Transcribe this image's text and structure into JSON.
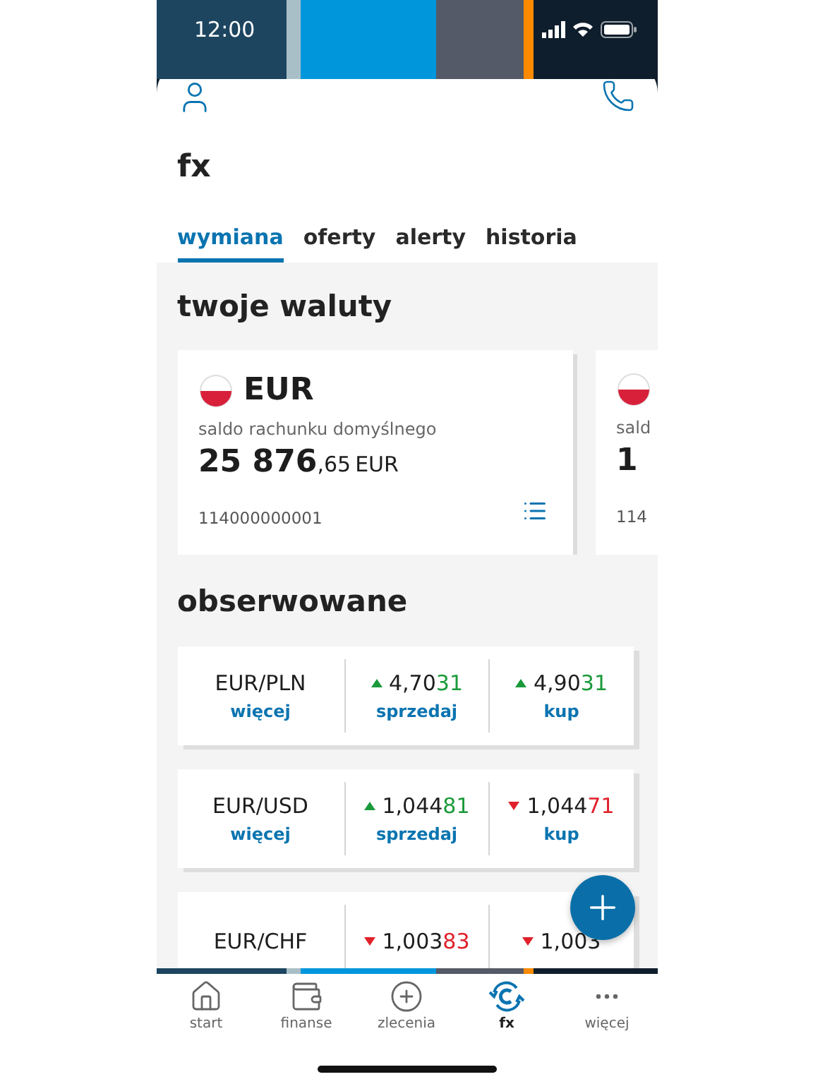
{
  "status_bar": {
    "time": "12:00"
  },
  "header": {
    "title": "fx"
  },
  "tabs": [
    {
      "label": "wymiana",
      "selected": true
    },
    {
      "label": "oferty",
      "selected": false
    },
    {
      "label": "alerty",
      "selected": false
    },
    {
      "label": "historia",
      "selected": false
    }
  ],
  "currencies": {
    "title": "twoje waluty",
    "cards": [
      {
        "currency": "EUR",
        "caption": "saldo rachunku domyślnego",
        "amount_main": "25 876",
        "amount_fraction": ",65",
        "amount_currency": "EUR",
        "account": "114000000001"
      },
      {
        "caption": "sald",
        "amount_main": "1",
        "account": "114"
      }
    ]
  },
  "watched": {
    "title": "obserwowane",
    "rows": [
      {
        "pair": "EUR/PLN",
        "link": "więcej",
        "sell": {
          "main": "4,70",
          "tail": "31",
          "rising": true
        },
        "sell_label": "sprzedaj",
        "buy": {
          "main": "4,90",
          "tail": "31",
          "rising": true
        },
        "buy_label": "kup"
      },
      {
        "pair": "EUR/USD",
        "link": "więcej",
        "sell": {
          "main": "1,044",
          "tail": "81",
          "rising": true
        },
        "sell_label": "sprzedaj",
        "buy": {
          "main": "1,044",
          "tail": "71",
          "rising": false
        },
        "buy_label": "kup"
      },
      {
        "pair": "EUR/CHF",
        "sell": {
          "main": "1,003",
          "tail": "83",
          "rising": false
        },
        "buy": {
          "main": "1,003",
          "rising": false
        }
      }
    ]
  },
  "bottom_nav": [
    {
      "label": "start",
      "kind": "home",
      "selected": false
    },
    {
      "label": "finanse",
      "kind": "wallet",
      "selected": false
    },
    {
      "label": "zlecenia",
      "kind": "plus",
      "selected": false
    },
    {
      "label": "fx",
      "kind": "fx",
      "selected": true
    },
    {
      "label": "więcej",
      "kind": "more",
      "selected": false
    }
  ]
}
